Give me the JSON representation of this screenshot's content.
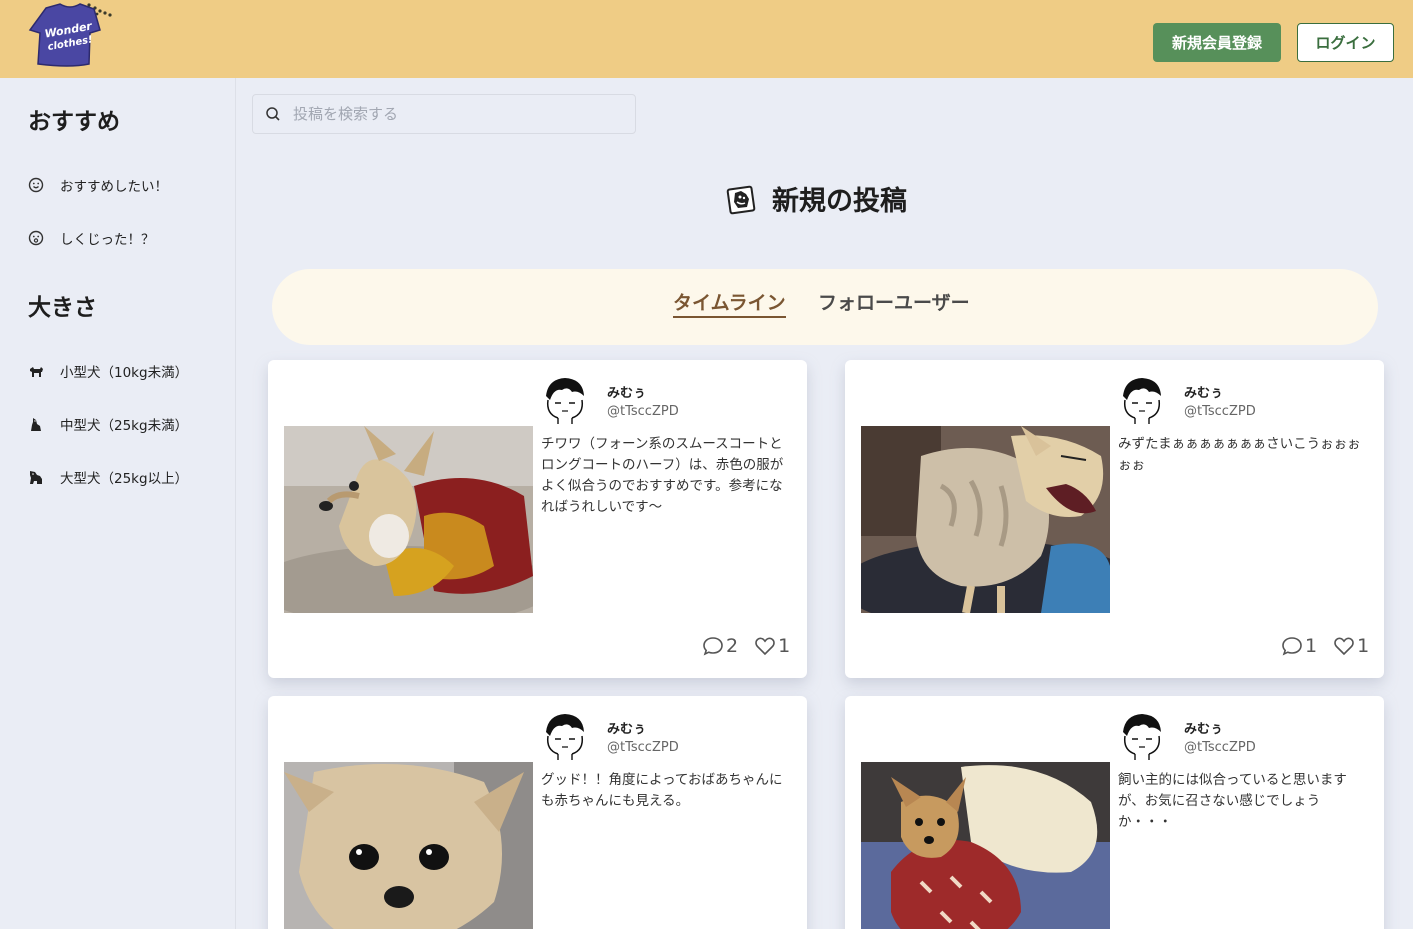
{
  "header": {
    "logo": {
      "text_line1": "Wonder",
      "text_line2": "clothes!"
    },
    "register_label": "新規会員登録",
    "login_label": "ログイン"
  },
  "sidebar": {
    "recommend_heading": "おすすめ",
    "recommend_items": [
      {
        "label": "おすすめしたい！",
        "icon": "smile-icon"
      },
      {
        "label": "しくじった！？",
        "icon": "surprised-icon"
      }
    ],
    "size_heading": "大きさ",
    "size_items": [
      {
        "label": "小型犬（10kg未満）",
        "icon": "small-dog-icon"
      },
      {
        "label": "中型犬（25kg未満）",
        "icon": "medium-dog-icon"
      },
      {
        "label": "大型犬（25kg以上）",
        "icon": "large-dog-icon"
      }
    ]
  },
  "search": {
    "placeholder": "投稿を検索する"
  },
  "new_post": {
    "label": "新規の投稿"
  },
  "tabs": [
    {
      "label": "タイムライン",
      "active": true
    },
    {
      "label": "フォローユーザー",
      "active": false
    }
  ],
  "posts": [
    {
      "user_name": "みむぅ",
      "user_id": "@tTsccZPD",
      "body": "チワワ（フォーン系のスムースコートとロングコートのハーフ）は、赤色の服がよく似合うのでおすすめです。参考になればうれしいです〜",
      "comments": "2",
      "likes": "1",
      "photo": "chihuahua-red-outfit"
    },
    {
      "user_name": "みむぅ",
      "user_id": "@tTsccZPD",
      "body": "みずたまぁぁぁぁぁぁぁさいこうぉぉぉぉぉ",
      "comments": "1",
      "likes": "1",
      "photo": "chihuahua-yawning"
    },
    {
      "user_name": "みむぅ",
      "user_id": "@tTsccZPD",
      "body": "グッド！！角度によっておばあちゃんにも赤ちゃんにも見える。",
      "comments": "",
      "likes": "",
      "photo": "chihuahua-closeup"
    },
    {
      "user_name": "みむぅ",
      "user_id": "@tTsccZPD",
      "body": "飼い主的には似合っていると思いますが、お気に召さない感じでしょうか・・・",
      "comments": "",
      "likes": "",
      "photo": "chihuahua-on-bed"
    }
  ],
  "colors": {
    "header_bg": "#efcc85",
    "register_bg": "#57905a",
    "page_bg": "#eaedf5",
    "tabs_bg": "#fdf8eb",
    "active_tab": "#7a5632"
  }
}
